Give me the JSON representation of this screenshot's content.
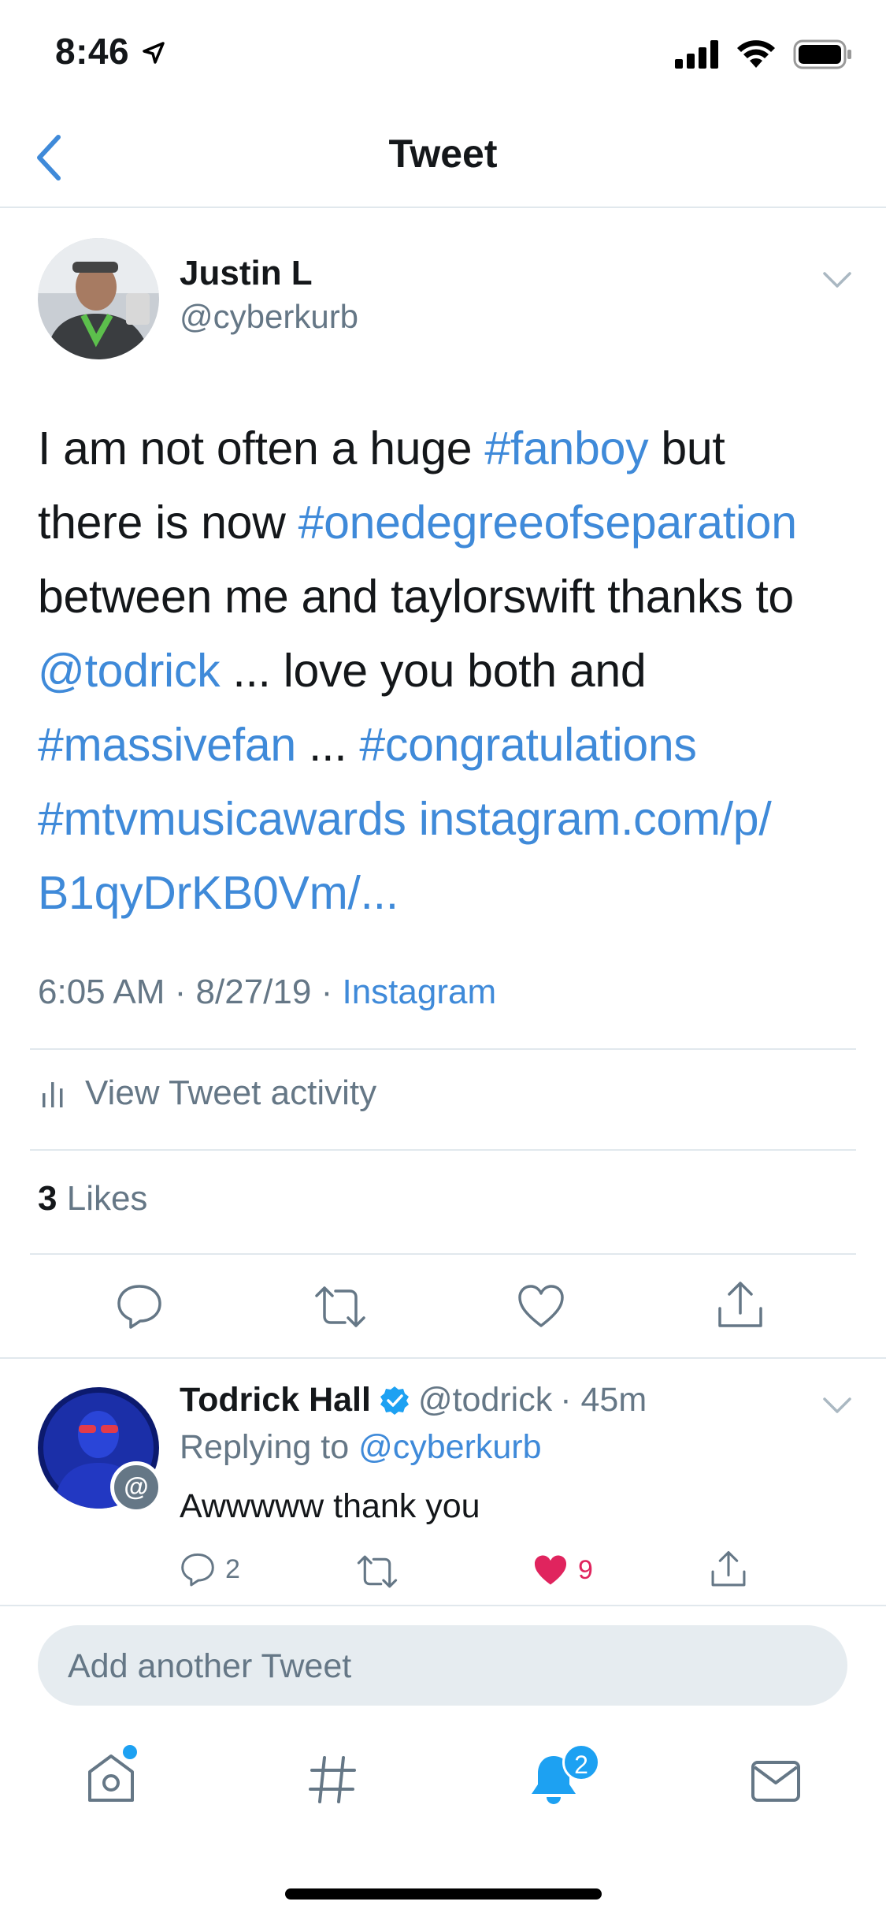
{
  "status_bar": {
    "time": "8:46"
  },
  "nav": {
    "title": "Tweet"
  },
  "tweet": {
    "author_name": "Justin L",
    "author_handle": "@cyberkurb",
    "text": {
      "s1": "I am not often a huge ",
      "fanboy": "#fanboy",
      "s2": " but",
      "s3": "there is now ",
      "onedegree": "#onedegreeofseparation",
      "s4": "between me and taylorswift thanks to",
      "todrick": "@todrick",
      "s5": " ... love you both and",
      "massivefan": "#massivefan",
      "s6": " ... ",
      "congrats": "#congratulations",
      "mtv": "#mtvmusicawards",
      "url1": "instagram.com/p/",
      "url2": "B1qyDrKB0Vm/..."
    },
    "time": "6:05 AM",
    "date": "8/27/19",
    "sep": " · ",
    "source": "Instagram",
    "activity_label": "View Tweet activity",
    "likes_count": "3",
    "likes_label": "Likes"
  },
  "reply": {
    "name": "Todrick Hall",
    "handle": "@todrick",
    "time": "· 45m",
    "replying_prefix": "Replying to",
    "replying_handle": "@cyberkurb",
    "text": "Awwwww thank you",
    "reply_count": "2",
    "like_count": "9"
  },
  "composer": {
    "placeholder": "Add another Tweet"
  },
  "tab_bar": {
    "notifications_badge": "2"
  },
  "colors": {
    "accent": "#1da1f2",
    "link": "#3f8ad9",
    "like": "#e0245e",
    "muted": "#657786"
  },
  "icons": [
    "back-chevron-icon",
    "chevron-down-icon",
    "bar-chart-icon",
    "reply-icon",
    "retweet-icon",
    "like-icon",
    "share-icon",
    "verified-badge-icon",
    "home-icon",
    "explore-hashtag-icon",
    "notifications-bell-icon",
    "messages-envelope-icon"
  ]
}
